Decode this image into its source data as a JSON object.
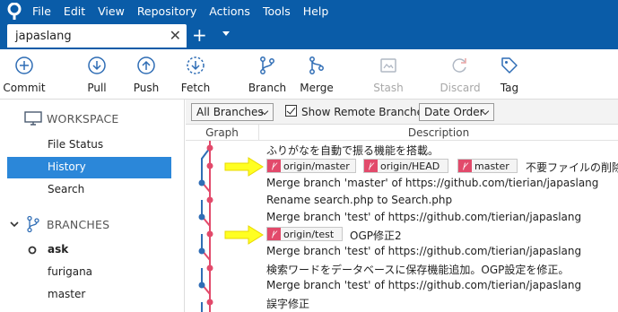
{
  "menu": {
    "items": [
      "File",
      "Edit",
      "View",
      "Repository",
      "Actions",
      "Tools",
      "Help"
    ]
  },
  "tabs": {
    "active_label": "japaslang",
    "close_glyph": "✕",
    "add_glyph": "+"
  },
  "toolbar": {
    "commit": "Commit",
    "pull": "Pull",
    "push": "Push",
    "fetch": "Fetch",
    "branch": "Branch",
    "merge": "Merge",
    "stash": "Stash",
    "discard": "Discard",
    "tag": "Tag"
  },
  "sidebar": {
    "workspace_label": "WORKSPACE",
    "workspace_items": [
      "File Status",
      "History",
      "Search"
    ],
    "active_item": "History",
    "branches_label": "BRANCHES",
    "branches": [
      "ask",
      "furigana",
      "master"
    ],
    "current_branch": "ask"
  },
  "filters": {
    "branches_select": "All Branches",
    "show_remote_label": "Show Remote Branches",
    "show_remote_checked": true,
    "order_select": "Date Order"
  },
  "columns": {
    "graph": "Graph",
    "description": "Description"
  },
  "commits": [
    {
      "refs": [],
      "message": "ふりがなを自動で振る機能を搭載。"
    },
    {
      "refs": [
        "origin/master",
        "origin/HEAD",
        "master"
      ],
      "message": "不要ファイルの削除"
    },
    {
      "refs": [],
      "message": "Merge branch 'master' of https://github.com/tierian/japaslang"
    },
    {
      "refs": [],
      "message": "Rename search.php to Search.php"
    },
    {
      "refs": [],
      "message": "Merge branch 'test' of https://github.com/tierian/japaslang"
    },
    {
      "refs": [
        "origin/test"
      ],
      "message": "OGP修正2"
    },
    {
      "refs": [],
      "message": "Merge branch 'test' of https://github.com/tierian/japaslang"
    },
    {
      "refs": [],
      "message": "検索ワードをデータベースに保存機能追加。OGP設定を修正。"
    },
    {
      "refs": [],
      "message": "Merge branch 'test' of https://github.com/tierian/japaslang"
    },
    {
      "refs": [],
      "message": "誤字修正"
    }
  ],
  "colors": {
    "menubar": "#0a5ca8",
    "accent": "#2b87d9",
    "graph_pink": "#e24a6b",
    "graph_blue": "#2f6db5",
    "arrow": "#ffff22"
  }
}
